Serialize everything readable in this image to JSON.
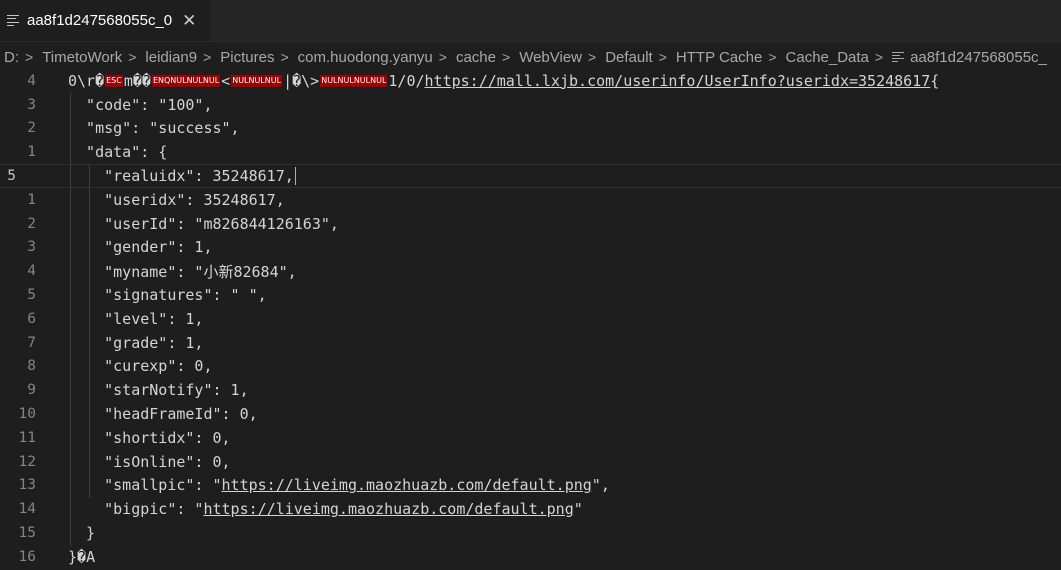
{
  "tab": {
    "title": "aa8f1d247568055c_0",
    "close_label": "✕"
  },
  "breadcrumb": [
    "D:",
    "TimetoWork",
    "leidian9",
    "Pictures",
    "com.huodong.yanyu",
    "cache",
    "WebView",
    "Default",
    "HTTP Cache",
    "Cache_Data",
    "aa8f1d247568055c_"
  ],
  "editor": {
    "header": {
      "ln": "4",
      "p1": "0\\r",
      "rep": "�",
      "c1": "ESC",
      "m": "m",
      "rep2": "��",
      "c2": "ENQNULNULNUL",
      "lt": "<",
      "c3": "NULNULNUL",
      "bar": "|",
      "rep3": "�",
      "bs": "\\>",
      "c4": "NULNULNULNUL",
      "path": "1/0/",
      "url": "https://mall.lxjb.com/userinfo/UserInfo?useridx=35248617",
      "brace": "{"
    },
    "lines": [
      {
        "ln": "3",
        "text": "  \"code\": \"100\","
      },
      {
        "ln": "2",
        "text": "  \"msg\": \"success\","
      },
      {
        "ln": "1",
        "text": "  \"data\": {"
      },
      {
        "ln": "5",
        "text": "    \"realuidx\": 35248617,",
        "current": true
      },
      {
        "ln": "1",
        "text": "    \"useridx\": 35248617,"
      },
      {
        "ln": "2",
        "text": "    \"userId\": \"m826844126163\","
      },
      {
        "ln": "3",
        "text": "    \"gender\": 1,"
      },
      {
        "ln": "4",
        "text": "    \"myname\": \"小新82684\","
      },
      {
        "ln": "5",
        "text": "    \"signatures\": \" \","
      },
      {
        "ln": "6",
        "text": "    \"level\": 1,"
      },
      {
        "ln": "7",
        "text": "    \"grade\": 1,"
      },
      {
        "ln": "8",
        "text": "    \"curexp\": 0,"
      },
      {
        "ln": "9",
        "text": "    \"starNotify\": 1,"
      },
      {
        "ln": "10",
        "text": "    \"headFrameId\": 0,"
      },
      {
        "ln": "11",
        "text": "    \"shortidx\": 0,"
      },
      {
        "ln": "12",
        "text": "    \"isOnline\": 0,"
      }
    ],
    "smallpic": {
      "ln": "13",
      "pre": "    \"smallpic\": \"",
      "url": "https://liveimg.maozhuazb.com/default.png",
      "post": "\","
    },
    "bigpic": {
      "ln": "14",
      "pre": "    \"bigpic\": \"",
      "url": "https://liveimg.maozhuazb.com/default.png",
      "post": "\""
    },
    "close1": {
      "ln": "15",
      "text": "  }"
    },
    "close2": {
      "ln": "16",
      "text": "}",
      "rep": "�",
      "tail": "A"
    }
  }
}
